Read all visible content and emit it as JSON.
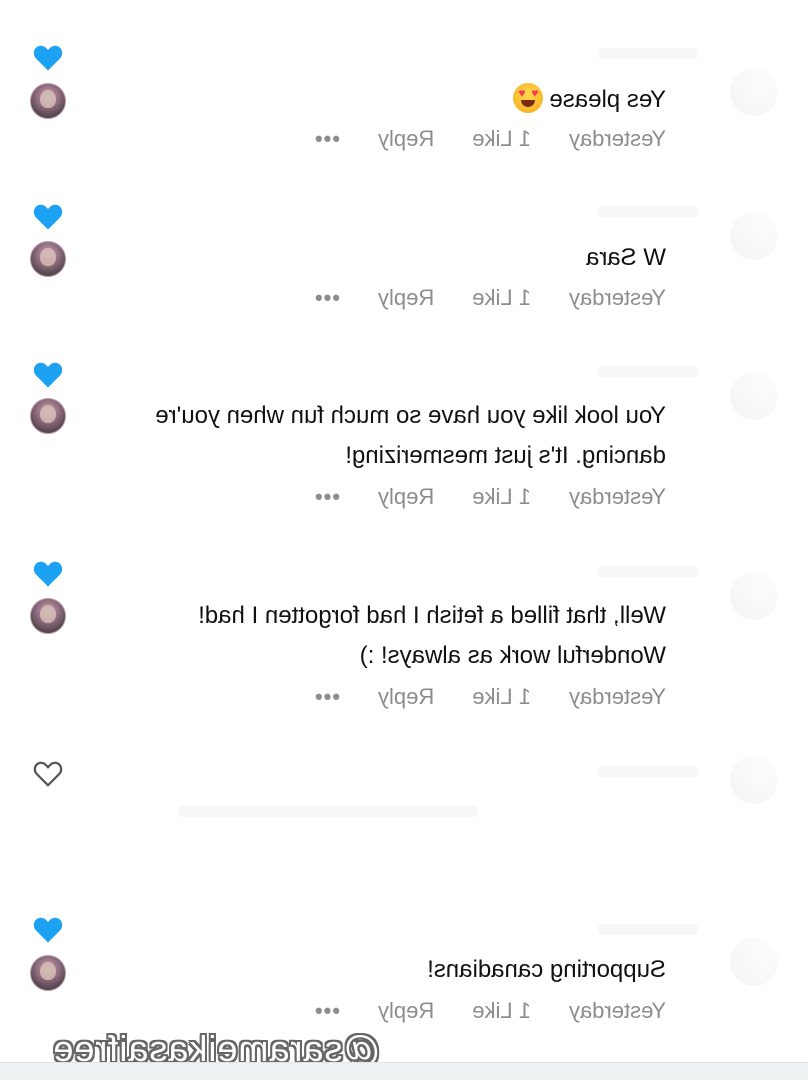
{
  "comments": [
    {
      "text": "Yes please",
      "emoji": "heart-eyes-emoji",
      "time": "Yesterday",
      "likes": "1 Like",
      "reply": "Reply",
      "more": "•••",
      "liked": true
    },
    {
      "text": "W Sara",
      "time": "Yesterday",
      "likes": "1 Like",
      "reply": "Reply",
      "more": "•••",
      "liked": true
    },
    {
      "text": "You look like you have so much fun when you're dancing. It's just mesmerizing!",
      "time": "Yesterday",
      "likes": "1 Like",
      "reply": "Reply",
      "more": "•••",
      "liked": true
    },
    {
      "text": "Well, that filled a fetish I had forgotten I had! Wonderful work as always! :)",
      "time": "Yesterday",
      "likes": "1 Like",
      "reply": "Reply",
      "more": "•••",
      "liked": true
    },
    {
      "text": "",
      "time": "",
      "likes": "",
      "reply": "",
      "more": "",
      "liked": false
    },
    {
      "text": "Supporting canadians!",
      "time": "Yesterday",
      "likes": "1 Like",
      "reply": "Reply",
      "more": "•••",
      "liked": true
    }
  ],
  "watermark": "@sarameikasaifree",
  "colors": {
    "heart_liked": "#1da1f2",
    "heart_outline": "#555555",
    "meta_text": "#8d8d8d",
    "body_text": "#111111"
  },
  "icons": {
    "like": "heart-icon",
    "creator_like": "creator-avatar",
    "more": "more-options-icon"
  }
}
